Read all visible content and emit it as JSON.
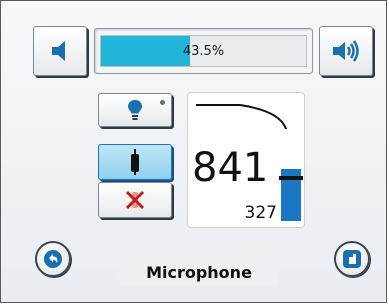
{
  "volume": {
    "percent_label": "43.5%",
    "level": 0.435,
    "fill_color": "#22b4d9"
  },
  "buttons": {
    "volume_down_icon": "speaker-low-icon",
    "volume_up_icon": "speaker-high-icon",
    "light_icon": "light-bulb-icon",
    "mic_on_icon": "microphone-icon",
    "mic_mute_icon": "mute-x-icon",
    "back_icon": "back-arrow-icon",
    "settings_icon": "tool-icon"
  },
  "level_panel": {
    "value": "841",
    "threshold": "327",
    "bar_level": 0.57,
    "marker_level": 0.45,
    "bar_color": "#1a77c4"
  },
  "footer": {
    "title": "Microphone"
  }
}
